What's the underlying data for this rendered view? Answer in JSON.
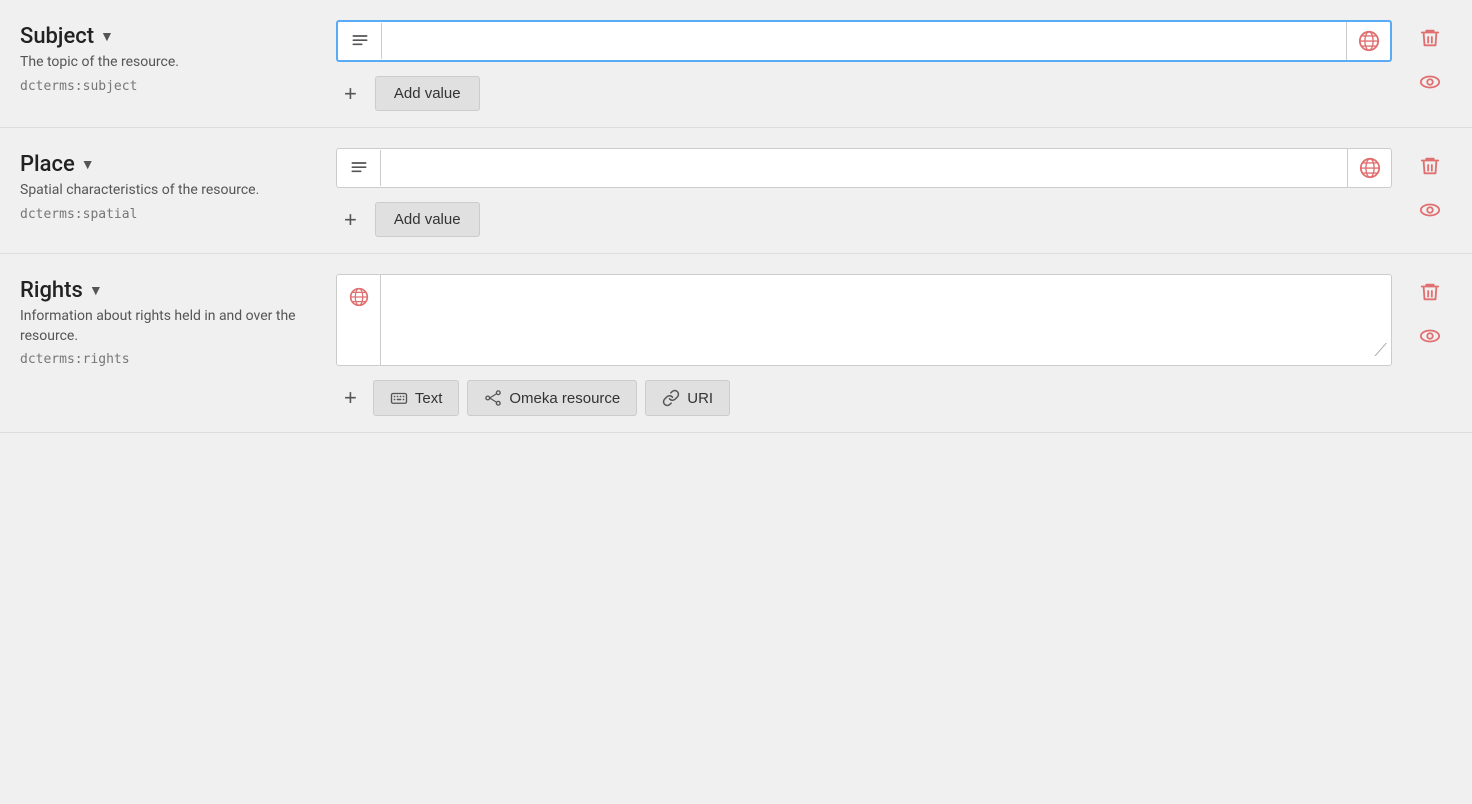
{
  "fields": [
    {
      "id": "subject",
      "title": "Subject",
      "description": "The topic of the resource.",
      "term": "dcterms:subject",
      "focused": true,
      "input_type": "text",
      "add_value_label": "Add value",
      "actions": [
        "delete",
        "visibility"
      ]
    },
    {
      "id": "place",
      "title": "Place",
      "description": "Spatial characteristics of the resource.",
      "term": "dcterms:spatial",
      "focused": false,
      "input_type": "text",
      "add_value_label": "Add value",
      "actions": [
        "delete",
        "visibility"
      ]
    },
    {
      "id": "rights",
      "title": "Rights",
      "description": "Information about rights held in and over the resource.",
      "term": "dcterms:rights",
      "focused": false,
      "input_type": "textarea",
      "buttons": [
        {
          "id": "text",
          "label": "Text",
          "icon": "keyboard"
        },
        {
          "id": "omeka-resource",
          "label": "Omeka resource",
          "icon": "nodes"
        },
        {
          "id": "uri",
          "label": "URI",
          "icon": "link"
        }
      ],
      "actions": [
        "delete",
        "visibility"
      ]
    }
  ],
  "ui": {
    "chevron": "▼",
    "plus": "+",
    "add_value": "Add value"
  }
}
